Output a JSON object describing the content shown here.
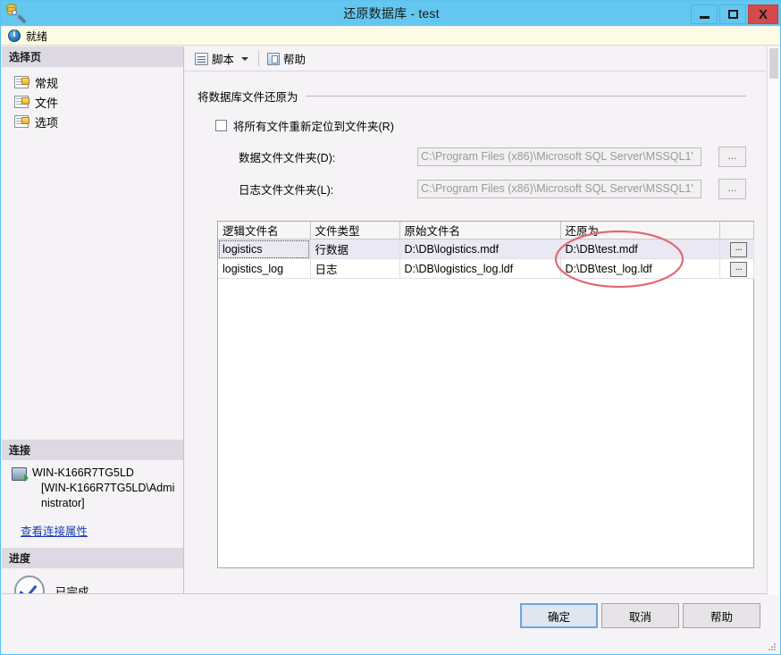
{
  "window": {
    "title": "还原数据库 - test",
    "icon": "restore-database-icon",
    "minimize_label": "",
    "maximize_label": "",
    "close_label": "X"
  },
  "status": {
    "icon": "info-icon",
    "text": "就绪"
  },
  "sidebar": {
    "select_page_header": "选择页",
    "items": [
      {
        "label": "常规",
        "icon": "page-icon"
      },
      {
        "label": "文件",
        "icon": "page-icon"
      },
      {
        "label": "选项",
        "icon": "page-icon"
      }
    ],
    "connection_header": "连接",
    "connection_server": "WIN-K166R7TG5LD",
    "connection_user": "[WIN-K166R7TG5LD\\Administrator]",
    "connection_link": "查看连接属性",
    "progress_header": "进度",
    "progress_text": "已完成",
    "progress_icon": "check-circle-icon"
  },
  "toolbar": {
    "script_label": "脚本",
    "script_icon": "script-icon",
    "help_label": "帮助",
    "help_icon": "help-icon"
  },
  "main": {
    "group_title": "将数据库文件还原为",
    "relocate_checkbox_label": "将所有文件重新定位到文件夹(R)",
    "relocate_checked": false,
    "data_folder_label": "数据文件文件夹(D):",
    "data_folder_value": "C:\\Program Files (x86)\\Microsoft SQL Server\\MSSQL1'",
    "log_folder_label": "日志文件文件夹(L):",
    "log_folder_value": "C:\\Program Files (x86)\\Microsoft SQL Server\\MSSQL1'",
    "browse_button_label": "...",
    "grid": {
      "columns": [
        "逻辑文件名",
        "文件类型",
        "原始文件名",
        "还原为",
        ""
      ],
      "rows": [
        {
          "logical_name": "logistics",
          "file_type": "行数据",
          "original_name": "D:\\DB\\logistics.mdf",
          "restore_as": "D:\\DB\\test.mdf",
          "button_label": "...",
          "selected": true
        },
        {
          "logical_name": "logistics_log",
          "file_type": "日志",
          "original_name": "D:\\DB\\logistics_log.ldf",
          "restore_as": "D:\\DB\\test_log.ldf",
          "button_label": "...",
          "selected": false
        }
      ]
    },
    "annotation": {
      "shape": "ellipse",
      "color": "#e06a72",
      "note": "红色椭圆标注还原为列"
    }
  },
  "footer": {
    "ok_label": "确定",
    "cancel_label": "取消",
    "help_label": "帮助"
  },
  "colors": {
    "titlebar": "#64c7f0",
    "close_button": "#d44a4a",
    "status_background": "#fdfbe3",
    "annotation": "#e06a72",
    "selection": "#e9e8f3"
  }
}
